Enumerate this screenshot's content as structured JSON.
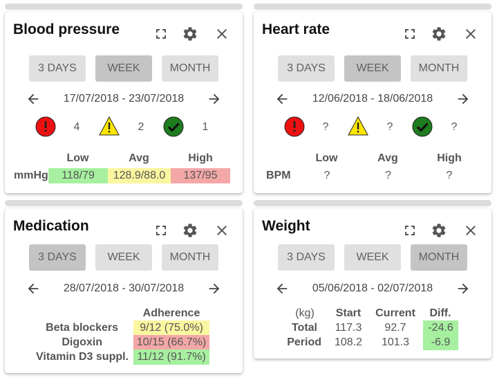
{
  "cards": {
    "bp": {
      "title": "Blood pressure",
      "ranges": [
        "3 DAYS",
        "WEEK",
        "MONTH"
      ],
      "date_range": "17/07/2018 - 23/07/2018",
      "status": {
        "red": "4",
        "yellow": "2",
        "green": "1"
      },
      "table": {
        "headers": [
          "Low",
          "Avg",
          "High"
        ],
        "unit": "mmHg",
        "values": [
          "118/79",
          "128.9/88.0",
          "137/95"
        ]
      }
    },
    "hr": {
      "title": "Heart rate",
      "ranges": [
        "3 DAYS",
        "WEEK",
        "MONTH"
      ],
      "date_range": "12/06/2018 - 18/06/2018",
      "status": {
        "red": "?",
        "yellow": "?",
        "green": "?"
      },
      "table": {
        "headers": [
          "Low",
          "Avg",
          "High"
        ],
        "unit": "BPM",
        "values": [
          "?",
          "?",
          "?"
        ]
      }
    },
    "med": {
      "title": "Medication",
      "ranges": [
        "3 DAYS",
        "WEEK",
        "MONTH"
      ],
      "date_range": "28/07/2018 - 30/07/2018",
      "table": {
        "header": "Adherence",
        "rows": [
          {
            "label": "Beta blockers",
            "value": "9/12 (75.0%)"
          },
          {
            "label": "Digoxin",
            "value": "10/15 (66.7%)"
          },
          {
            "label": "Vitamin D3 suppl.",
            "value": "11/12 (91.7%)"
          }
        ]
      }
    },
    "wt": {
      "title": "Weight",
      "ranges": [
        "3 DAYS",
        "WEEK",
        "MONTH"
      ],
      "date_range": "05/06/2018 - 02/07/2018",
      "table": {
        "unit": "(kg)",
        "headers": [
          "Start",
          "Current",
          "Diff."
        ],
        "rows": [
          {
            "label": "Total",
            "start": "117.3",
            "current": "92.7",
            "diff": "-24.6"
          },
          {
            "label": "Period",
            "start": "108.2",
            "current": "101.3",
            "diff": "-6.9"
          }
        ]
      }
    }
  },
  "colors": {
    "good": "#a6f0a0",
    "warn": "#fbf6a0",
    "bad": "#f4a7a7",
    "button": "#e0e0e0",
    "button_active": "#c4c4c4",
    "alert_red": "#ee1111",
    "alert_yellow": "#ffe600",
    "ok_green": "#1e7d1e"
  },
  "icons": [
    "fullscreen-icon",
    "gear-icon",
    "close-icon",
    "arrow-left-icon",
    "arrow-right-icon",
    "alert-circle-icon",
    "warning-triangle-icon",
    "check-circle-icon"
  ]
}
